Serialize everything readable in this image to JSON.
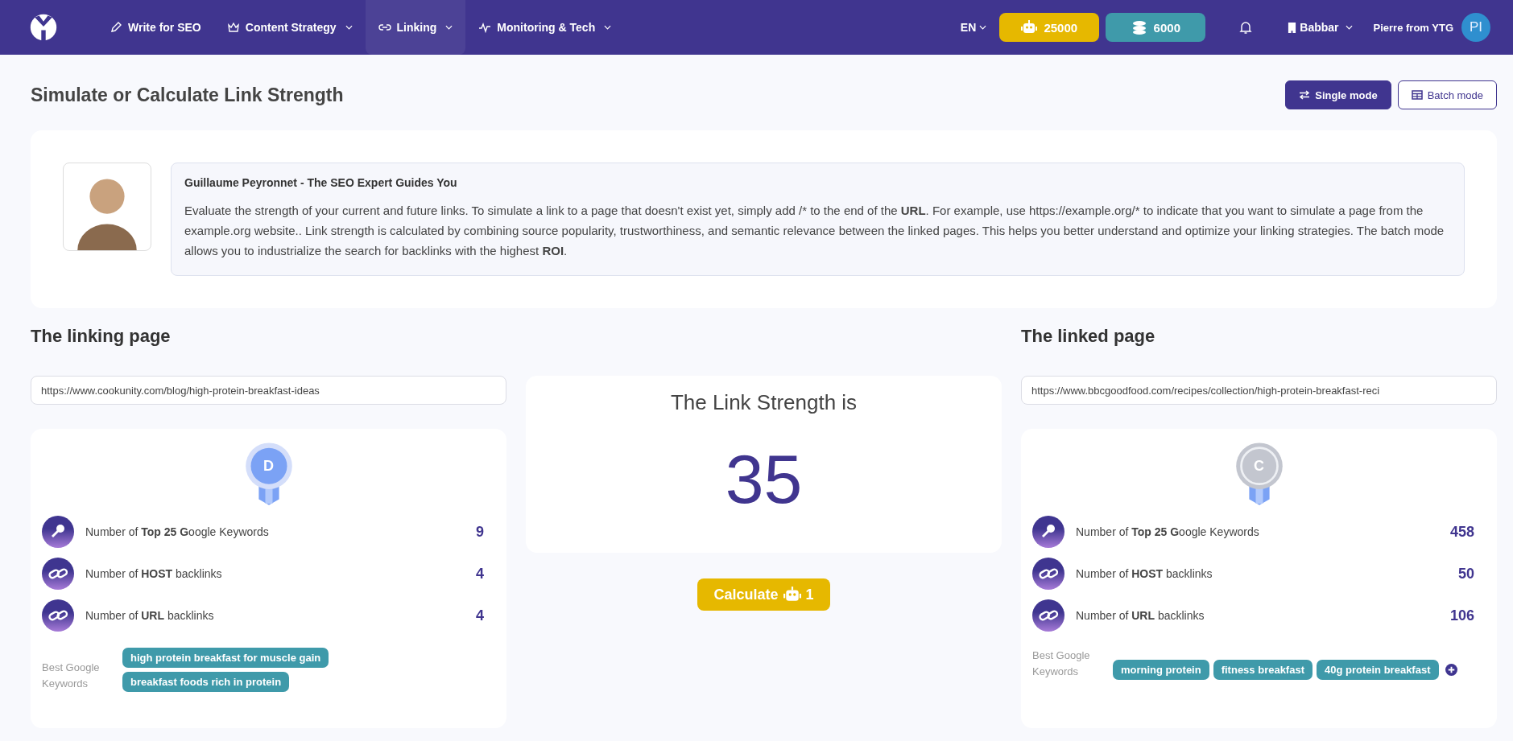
{
  "nav": {
    "items": [
      {
        "label": "Write for SEO",
        "kind": "pencil",
        "dropdown": false,
        "selected": false
      },
      {
        "label": "Content Strategy",
        "kind": "crown",
        "dropdown": true,
        "selected": false
      },
      {
        "label": "Linking",
        "kind": "link",
        "dropdown": true,
        "selected": true
      },
      {
        "label": "Monitoring & Tech",
        "kind": "pulse",
        "dropdown": true,
        "selected": false
      }
    ],
    "language": "EN",
    "credits": [
      {
        "kind": "robot",
        "value": "25000",
        "color": "#e6b800"
      },
      {
        "kind": "coins",
        "value": "6000",
        "color": "#3f9aaa"
      }
    ],
    "workspace": "Babbar",
    "user": "Pierre from YTG",
    "avatar": "PI"
  },
  "title": "Simulate or Calculate Link Strength",
  "modes": [
    {
      "label": "Single mode",
      "kind": "swap",
      "selected": true
    },
    {
      "label": "Batch mode",
      "kind": "table",
      "selected": false
    }
  ],
  "intro": {
    "heading": "Guillaume Peyronnet - The SEO Expert Guides You",
    "text": "Evaluate the strength of your current and future links. To simulate a link to a page that doesn't exist yet, simply add /* to the end of the **URL**. For example, use https://example.org/* to indicate that you want to simulate a page from the example.org website.. Link strength is calculated by combining source popularity, trustworthiness, and semantic relevance between the linked pages. This helps you better understand and optimize your linking strategies. The batch mode allows you to industrialize the search for backlinks with the highest **ROI**."
  },
  "linking": {
    "heading": "The linking page",
    "url": "https://www.cookunity.com/blog/high-protein-breakfast-ideas",
    "medal": {
      "grade": "D",
      "color": "#7ba2f5"
    },
    "stats": [
      {
        "kind": "key",
        "label": "Number of **Top 25 G**oogle Keywords",
        "value": "9"
      },
      {
        "kind": "chain",
        "label": "Number of **HOST** backlinks",
        "value": "4"
      },
      {
        "kind": "chain",
        "label": "Number of **URL** backlinks",
        "value": "4"
      }
    ],
    "keywords_label": "Best Google Keywords",
    "keywords": [
      "high protein breakfast for muscle gain",
      "breakfast foods rich in protein"
    ],
    "more": false
  },
  "result": {
    "heading": "The Link Strength is",
    "value": "35",
    "button": "Calculate",
    "cost": "1"
  },
  "linked": {
    "heading": "The linked page",
    "url": "https://www.bbcgoodfood.com/recipes/collection/high-protein-breakfast-reci",
    "medal": {
      "grade": "C",
      "color": "#c3c6cf"
    },
    "stats": [
      {
        "kind": "key",
        "label": "Number of **Top 25 G**oogle Keywords",
        "value": "458"
      },
      {
        "kind": "chain",
        "label": "Number of **HOST** backlinks",
        "value": "50"
      },
      {
        "kind": "chain",
        "label": "Number of **URL** backlinks",
        "value": "106"
      }
    ],
    "keywords_label": "Best Google Keywords",
    "keywords": [
      "morning protein",
      "fitness breakfast",
      "40g protein breakfast"
    ],
    "more": true
  }
}
